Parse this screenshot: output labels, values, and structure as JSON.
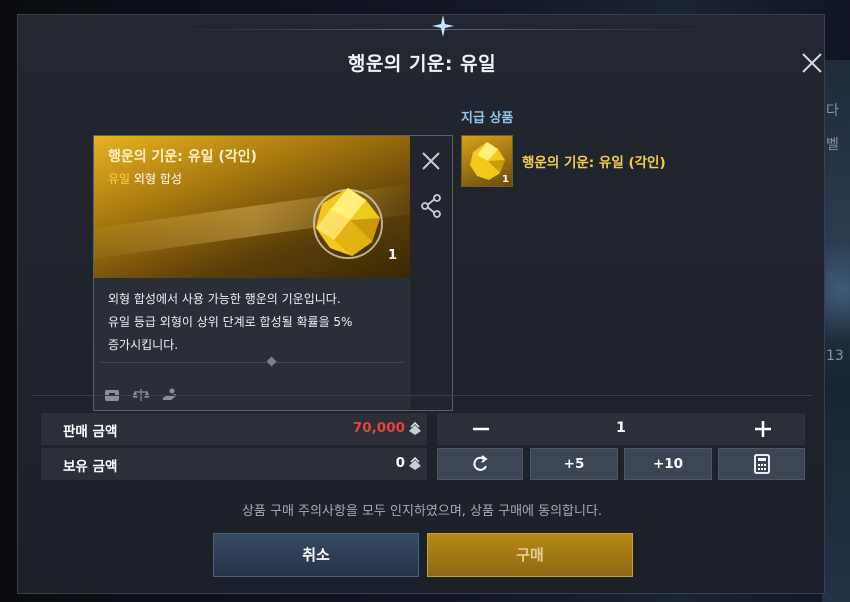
{
  "background": {
    "right_texts": [
      "다",
      "벨 ",
      "13"
    ]
  },
  "dialog": {
    "title": "행운의 기운: 유일",
    "close_icon": "close-icon"
  },
  "item": {
    "name": "행운의 기운: 유일 (각인)",
    "grade": "유일",
    "category": "외형 합성",
    "count": "1",
    "description": [
      "외형 합성에서 사용 가능한 행운의 기운입니다.",
      "유일 등급 외형이 상위 단계로 합성될 확률을 5%",
      "증가시킵니다."
    ],
    "icons": [
      "storage-icon",
      "scale-icon",
      "hand-icon"
    ]
  },
  "payment": {
    "label": "지급 상품",
    "item_name": "행운의 기운: 유일 (각인)",
    "count": "1"
  },
  "price": {
    "sale_label": "판매 금액",
    "sale_value": "70,000",
    "owned_label": "보유 금액",
    "owned_value": "0"
  },
  "quantity": {
    "value": "1",
    "buttons": [
      "+5",
      "+10"
    ]
  },
  "notice": "상품 구매 주의사항을 모두 인지하였으며, 상품 구매에 동의합니다.",
  "buttons": {
    "cancel": "취소",
    "buy": "구매"
  },
  "colors": {
    "price_red": "#e8423a",
    "gold": "#f5cc4a",
    "blue_label": "#8fc6ec"
  }
}
